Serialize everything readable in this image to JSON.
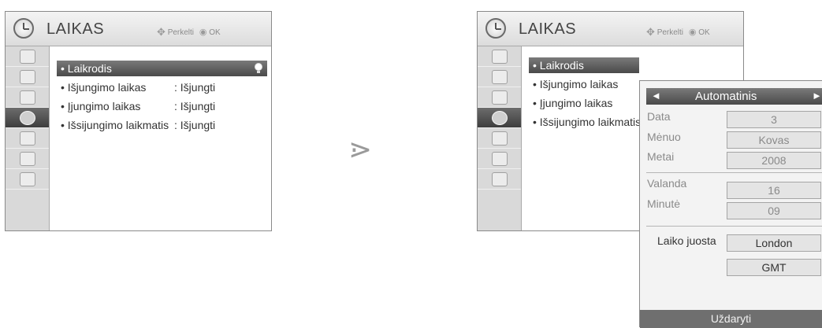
{
  "left_menu": {
    "title": "LAIKAS",
    "hint_move": "Perkelti",
    "hint_ok": "OK",
    "items": [
      {
        "label": "• Laikrodis",
        "value": ""
      },
      {
        "label": "• Išjungimo laikas",
        "value": ": Išjungti"
      },
      {
        "label": "• Įjungimo laikas",
        "value": ": Išjungti"
      },
      {
        "label": "• Išsijungimo laikmatis",
        "value": ": Išjungti"
      }
    ]
  },
  "right_menu": {
    "title": "LAIKAS",
    "hint_move": "Perkelti",
    "hint_ok": "OK",
    "items": [
      {
        "label": "• Laikrodis"
      },
      {
        "label": "• Išjungimo laikas"
      },
      {
        "label": "• Įjungimo laikas"
      },
      {
        "label": "• Išsijungimo laikmatis"
      }
    ]
  },
  "arrow": "⋗",
  "clock_popup": {
    "mode_left_arrow": "◄",
    "mode": "Automatinis",
    "mode_right_arrow": "►",
    "date_label": "Data",
    "date_value": "3",
    "month_label": "Mėnuo",
    "month_value": "Kovas",
    "year_label": "Metai",
    "year_value": "2008",
    "hour_label": "Valanda",
    "hour_value": "16",
    "minute_label": "Minutė",
    "minute_value": "09",
    "timezone_label": "Laiko juosta",
    "timezone_value": "London",
    "offset_value": "GMT",
    "close_label": "Uždaryti"
  },
  "icons": [
    "clock-icon",
    "picture-icon",
    "display-icon",
    "audio-icon",
    "time-icon",
    "lock-icon",
    "option-icon",
    "input-icon",
    "move-icon",
    "ok-icon",
    "bulb-icon"
  ],
  "colors": {
    "highlight": "#5a5a5a",
    "sidebar": "#d9d9d9",
    "text": "#333333",
    "muted": "#8a8a8a"
  }
}
